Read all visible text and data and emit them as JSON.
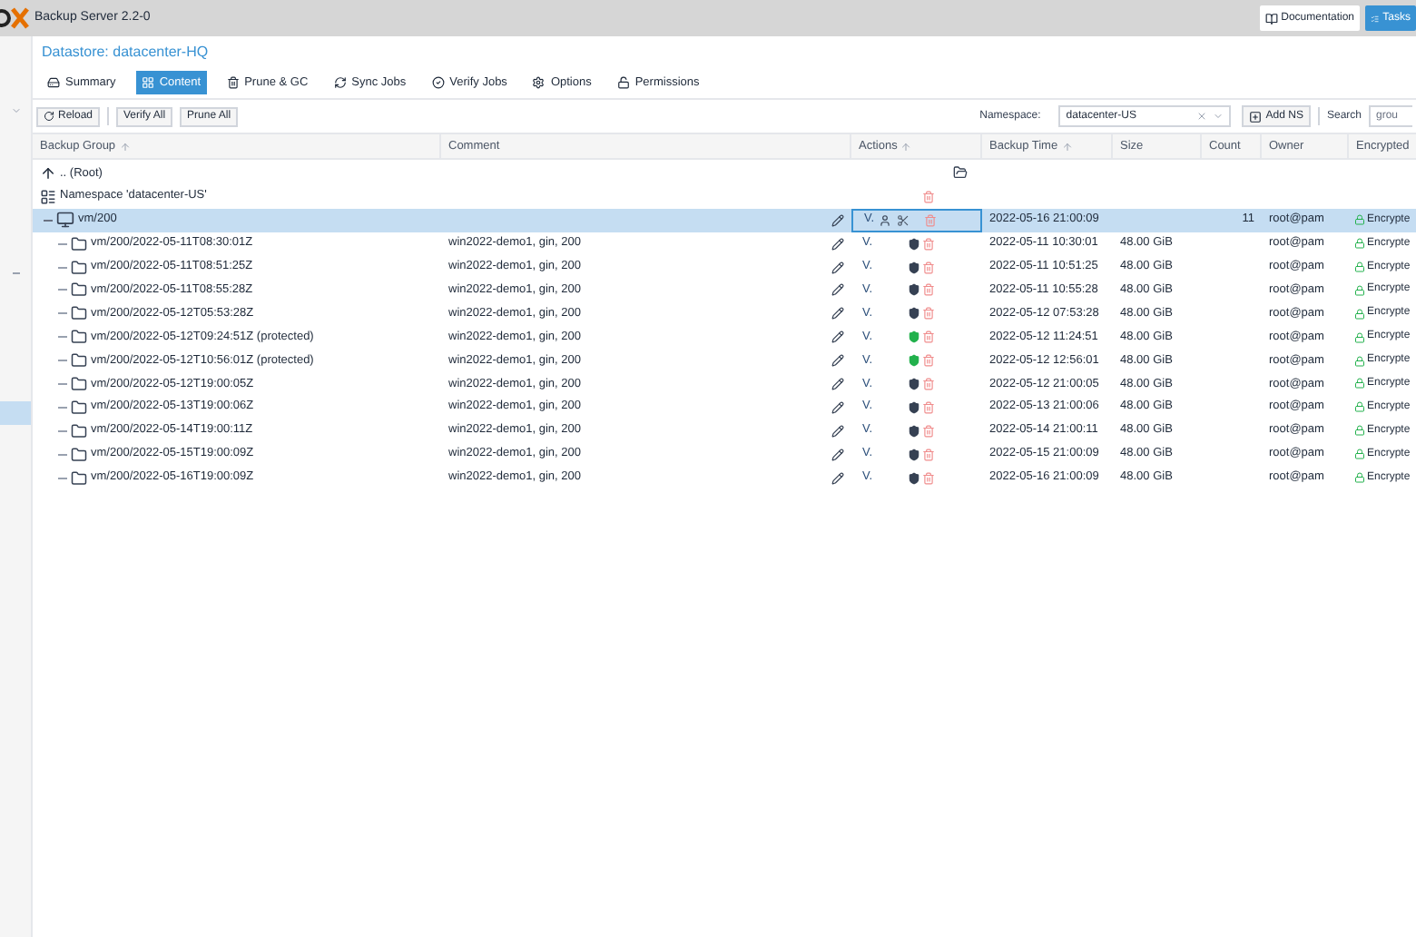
{
  "header": {
    "title": "Backup Server 2.2-0",
    "buttons": [
      {
        "label": "Documentation",
        "kind": "plain"
      },
      {
        "label": "Tasks",
        "kind": "primary"
      }
    ]
  },
  "panel_title": "Datastore: datacenter-HQ",
  "tabs": [
    {
      "label": "Summary",
      "selected": false
    },
    {
      "label": "Content",
      "selected": true
    },
    {
      "label": "Prune & GC",
      "selected": false
    },
    {
      "label": "Sync Jobs",
      "selected": false
    },
    {
      "label": "Verify Jobs",
      "selected": false
    },
    {
      "label": "Options",
      "selected": false
    },
    {
      "label": "Permissions",
      "selected": false
    }
  ],
  "toolbar": {
    "reload": "Reload",
    "verify_all": "Verify All",
    "prune_all": "Prune All",
    "namespace_label": "Namespace:",
    "namespace_value": "datacenter-US",
    "add_ns": "Add NS",
    "search_label": "Search",
    "search_placeholder": "grou"
  },
  "table": {
    "columns": [
      {
        "label": "Backup Group",
        "sorted": true
      },
      {
        "label": "Comment",
        "sorted": false
      },
      {
        "label": "Actions",
        "sorted": true
      },
      {
        "label": "Backup Time",
        "sorted": true
      },
      {
        "label": "Size",
        "sorted": false
      },
      {
        "label": "Count",
        "sorted": false
      },
      {
        "label": "Owner",
        "sorted": false
      },
      {
        "label": "Encrypted",
        "sorted": false
      }
    ],
    "rows": [
      {
        "kind": "root",
        "name": ".. (Root)"
      },
      {
        "kind": "namespace",
        "name": "Namespace 'datacenter-US'"
      },
      {
        "kind": "group",
        "name": "vm/200",
        "selected": true,
        "verify": "V.",
        "time": "2022-05-16 21:00:09",
        "count": "11",
        "owner": "root@pam",
        "encrypted": "Encrypte"
      },
      {
        "kind": "snapshot",
        "name": "vm/200/2022-05-11T08:30:01Z",
        "comment": "win2022-demo1, gin, 200",
        "verify": "V.",
        "protected": false,
        "time": "2022-05-11 10:30:01",
        "size": "48.00 GiB",
        "owner": "root@pam",
        "encrypted": "Encrypte"
      },
      {
        "kind": "snapshot",
        "name": "vm/200/2022-05-11T08:51:25Z",
        "comment": "win2022-demo1, gin, 200",
        "verify": "V.",
        "protected": false,
        "time": "2022-05-11 10:51:25",
        "size": "48.00 GiB",
        "owner": "root@pam",
        "encrypted": "Encrypte"
      },
      {
        "kind": "snapshot",
        "name": "vm/200/2022-05-11T08:55:28Z",
        "comment": "win2022-demo1, gin, 200",
        "verify": "V.",
        "protected": false,
        "time": "2022-05-11 10:55:28",
        "size": "48.00 GiB",
        "owner": "root@pam",
        "encrypted": "Encrypte"
      },
      {
        "kind": "snapshot",
        "name": "vm/200/2022-05-12T05:53:28Z",
        "comment": "win2022-demo1, gin, 200",
        "verify": "V.",
        "protected": false,
        "time": "2022-05-12 07:53:28",
        "size": "48.00 GiB",
        "owner": "root@pam",
        "encrypted": "Encrypte"
      },
      {
        "kind": "snapshot",
        "name": "vm/200/2022-05-12T09:24:51Z (protected)",
        "comment": "win2022-demo1, gin, 200",
        "verify": "V.",
        "protected": true,
        "time": "2022-05-12 11:24:51",
        "size": "48.00 GiB",
        "owner": "root@pam",
        "encrypted": "Encrypte"
      },
      {
        "kind": "snapshot",
        "name": "vm/200/2022-05-12T10:56:01Z (protected)",
        "comment": "win2022-demo1, gin, 200",
        "verify": "V.",
        "protected": true,
        "time": "2022-05-12 12:56:01",
        "size": "48.00 GiB",
        "owner": "root@pam",
        "encrypted": "Encrypte"
      },
      {
        "kind": "snapshot",
        "name": "vm/200/2022-05-12T19:00:05Z",
        "comment": "win2022-demo1, gin, 200",
        "verify": "V.",
        "protected": false,
        "time": "2022-05-12 21:00:05",
        "size": "48.00 GiB",
        "owner": "root@pam",
        "encrypted": "Encrypte"
      },
      {
        "kind": "snapshot",
        "name": "vm/200/2022-05-13T19:00:06Z",
        "comment": "win2022-demo1, gin, 200",
        "verify": "V.",
        "protected": false,
        "time": "2022-05-13 21:00:06",
        "size": "48.00 GiB",
        "owner": "root@pam",
        "encrypted": "Encrypte"
      },
      {
        "kind": "snapshot",
        "name": "vm/200/2022-05-14T19:00:11Z",
        "comment": "win2022-demo1, gin, 200",
        "verify": "V.",
        "protected": false,
        "time": "2022-05-14 21:00:11",
        "size": "48.00 GiB",
        "owner": "root@pam",
        "encrypted": "Encrypte"
      },
      {
        "kind": "snapshot",
        "name": "vm/200/2022-05-15T19:00:09Z",
        "comment": "win2022-demo1, gin, 200",
        "verify": "V.",
        "protected": false,
        "time": "2022-05-15 21:00:09",
        "size": "48.00 GiB",
        "owner": "root@pam",
        "encrypted": "Encrypte"
      },
      {
        "kind": "snapshot",
        "name": "vm/200/2022-05-16T19:00:09Z",
        "comment": "win2022-demo1, gin, 200",
        "verify": "V.",
        "protected": false,
        "time": "2022-05-16 21:00:09",
        "size": "48.00 GiB",
        "owner": "root@pam",
        "encrypted": "Encrypte"
      }
    ]
  }
}
